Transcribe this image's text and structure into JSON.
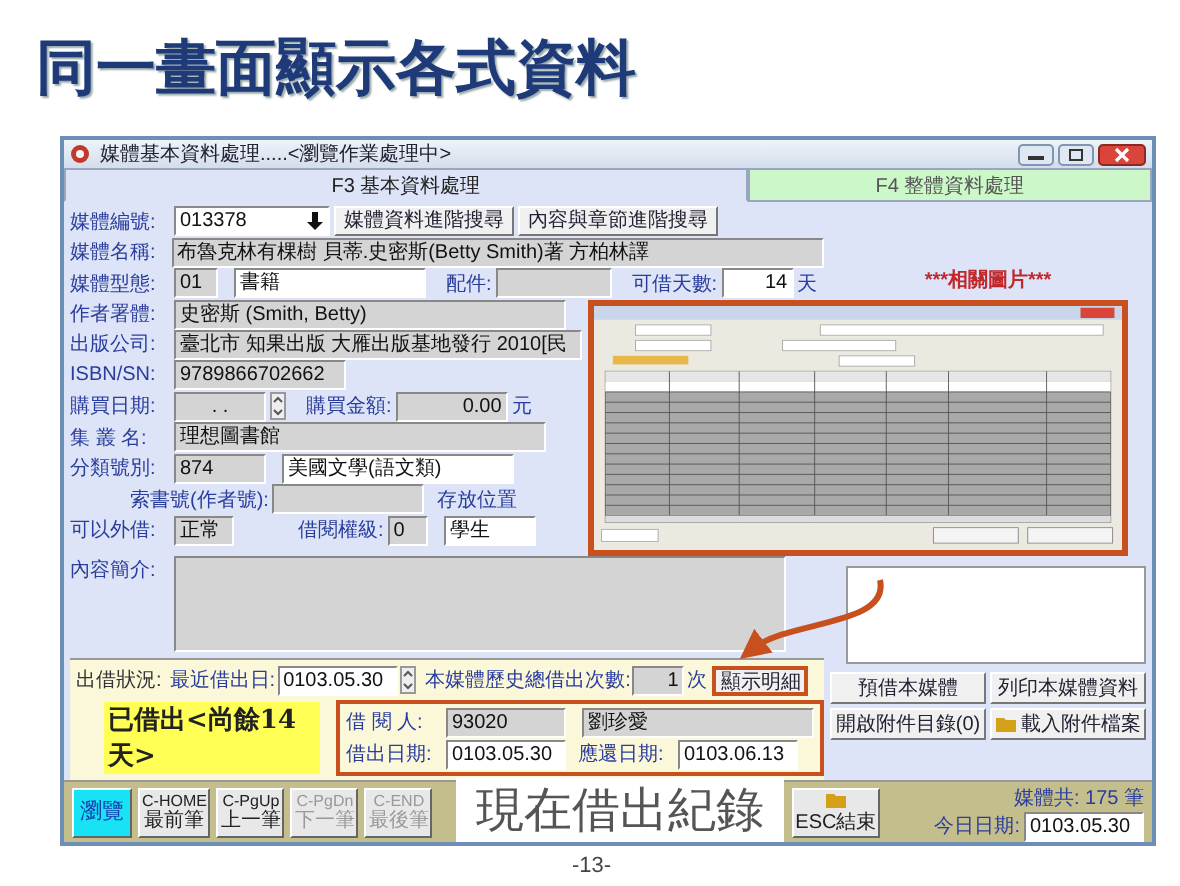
{
  "slide_title": "同一畫面顯示各式資料",
  "window": {
    "title": "媒體基本資料處理.....<瀏覽作業處理中>"
  },
  "tabs": [
    {
      "label": "F3 基本資料處理",
      "selected": true
    },
    {
      "label": "F4 整體資料處理",
      "selected": false
    }
  ],
  "media_no": {
    "label": "媒體編號:",
    "value": "013378"
  },
  "search_buttons": [
    "媒體資料進階搜尋",
    "內容與章節進階搜尋"
  ],
  "media_title": {
    "label": "媒體名稱:",
    "value": "布魯克林有棵樹 貝蒂.史密斯(Betty Smith)著 方柏林譯"
  },
  "media_type": {
    "label": "媒體型態:",
    "code": "01",
    "value": "書籍"
  },
  "accessory": {
    "label": "配件:"
  },
  "loan_days": {
    "label": "可借天數:",
    "value": "14",
    "unit": "天"
  },
  "author": {
    "label": "作者署體:",
    "value": "史密斯 (Smith, Betty)"
  },
  "publisher": {
    "label": "出版公司:",
    "value": "臺北市 知果出版 大雁出版基地發行 2010[民"
  },
  "isbn": {
    "label": "ISBN/SN:",
    "value": "9789866702662"
  },
  "purchase_date": {
    "label": "購買日期:",
    "value": ". ."
  },
  "purchase_amount": {
    "label": "購買金額:",
    "value": "0.00",
    "unit": "元"
  },
  "series": {
    "label": "集 叢 名:",
    "value": "理想圖書館"
  },
  "classification": {
    "label": "分類號別:",
    "code": "874",
    "value": "美國文學(語文類)"
  },
  "call_number": {
    "label": "索書號(作者號):"
  },
  "storage": {
    "label": "存放位置"
  },
  "lendable": {
    "label": "可以外借:",
    "value": "正常"
  },
  "loan_level": {
    "label": "借閱權級:",
    "code": "0",
    "value": "學生"
  },
  "summary": {
    "label": "內容簡介:"
  },
  "picture_label": "***相關圖片***",
  "loan": {
    "label": "出借狀況:",
    "last_date_label": "最近借出日:",
    "last_date": "0103.05.30",
    "count_label": "本媒體歷史總借出次數:",
    "count": "1",
    "count_unit": "次",
    "detail_button": "顯示明細",
    "status": "已借出<尚餘14天>",
    "borrower_label": "借 閱 人:",
    "borrower_id": "93020",
    "borrower_name": "劉珍愛",
    "out_date_label": "借出日期:",
    "out_date": "0103.05.30",
    "due_label": "應還日期:",
    "due_date": "0103.06.13"
  },
  "actions": [
    {
      "label": "預借本媒體",
      "kind": "text"
    },
    {
      "label": "列印本媒體資料",
      "kind": "text"
    },
    {
      "label": "開啟附件目錄(0)",
      "kind": "text"
    },
    {
      "label": "載入附件檔案",
      "kind": "file"
    }
  ],
  "nav_buttons": [
    {
      "kind": "mode",
      "label": "瀏覽",
      "selected": true,
      "disabled": false
    },
    {
      "kind": "nav",
      "key": "C-HOME",
      "label": "最前筆",
      "selected": false,
      "disabled": false
    },
    {
      "kind": "nav",
      "key": "C-PgUp",
      "label": "上一筆",
      "selected": false,
      "disabled": false
    },
    {
      "kind": "nav",
      "key": "C-PgDn",
      "label": "下一筆",
      "selected": false,
      "disabled": true
    },
    {
      "kind": "nav",
      "key": "C-END",
      "label": "最後筆",
      "selected": false,
      "disabled": true
    }
  ],
  "exit_button": "ESC結束",
  "record_count": "媒體共: 175 筆",
  "today": {
    "label": "今日日期:",
    "value": "0103.05.30"
  },
  "callout": "現在借出紀錄",
  "page_number": "-13-"
}
